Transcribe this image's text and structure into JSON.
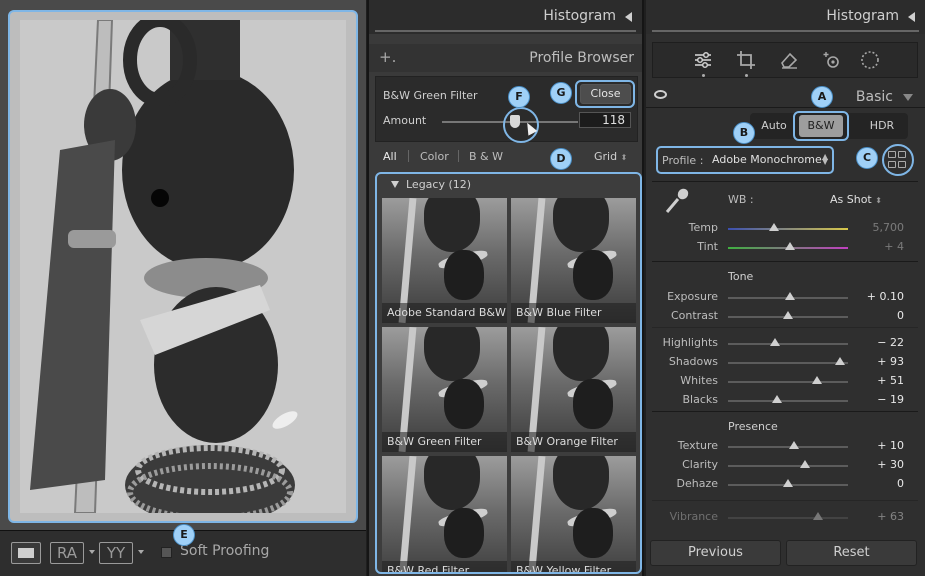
{
  "left": {
    "view_buttons": {
      "ra": "RA",
      "yy": "YY"
    },
    "soft_proofing_label": "Soft Proofing"
  },
  "middle": {
    "header_title": "Histogram",
    "profile_browser_title": "Profile Browser",
    "add_symbol": "+.",
    "filter_name": "B&W Green Filter",
    "close_label": "Close",
    "amount_label": "Amount",
    "amount_value": "118",
    "amount_fraction": 0.54,
    "filter_tabs": [
      "All",
      "Color",
      "B & W"
    ],
    "grid_label": "Grid",
    "group_label": "Legacy (12)",
    "thumbnails": [
      "Adobe Standard B&W",
      "B&W Blue Filter",
      "B&W Green Filter",
      "B&W Orange Filter",
      "B&W Red Filter",
      "B&W Yellow Filter"
    ]
  },
  "right": {
    "header_title": "Histogram",
    "panel_title": "Basic",
    "treatment": {
      "auto": "Auto",
      "bw": "B&W",
      "hdr": "HDR",
      "selected": "B&W"
    },
    "profile_label": "Profile :",
    "profile_value": "Adobe Monochrome",
    "wb_label": "WB :",
    "wb_value": "As Shot",
    "wb_sliders": [
      {
        "label": "Temp",
        "value": "5,700",
        "pos": 0.38,
        "faded": true
      },
      {
        "label": "Tint",
        "value": "+ 4",
        "pos": 0.52,
        "faded": true
      }
    ],
    "tone_title": "Tone",
    "tone_sliders": [
      {
        "label": "Exposure",
        "value": "+ 0.10",
        "pos": 0.52
      },
      {
        "label": "Contrast",
        "value": "0",
        "pos": 0.5
      }
    ],
    "tone_sliders2": [
      {
        "label": "Highlights",
        "value": "− 22",
        "pos": 0.39
      },
      {
        "label": "Shadows",
        "value": "+ 93",
        "pos": 0.93
      },
      {
        "label": "Whites",
        "value": "+ 51",
        "pos": 0.74
      },
      {
        "label": "Blacks",
        "value": "− 19",
        "pos": 0.41
      }
    ],
    "presence_title": "Presence",
    "presence_sliders": [
      {
        "label": "Texture",
        "value": "+ 10",
        "pos": 0.55
      },
      {
        "label": "Clarity",
        "value": "+ 30",
        "pos": 0.64
      },
      {
        "label": "Dehaze",
        "value": "0",
        "pos": 0.5
      }
    ],
    "vibrance": {
      "label": "Vibrance",
      "value": "+ 63",
      "pos": 0.75
    },
    "previous_label": "Previous",
    "reset_label": "Reset"
  },
  "annotations": [
    "A",
    "B",
    "C",
    "D",
    "E",
    "F",
    "G"
  ]
}
